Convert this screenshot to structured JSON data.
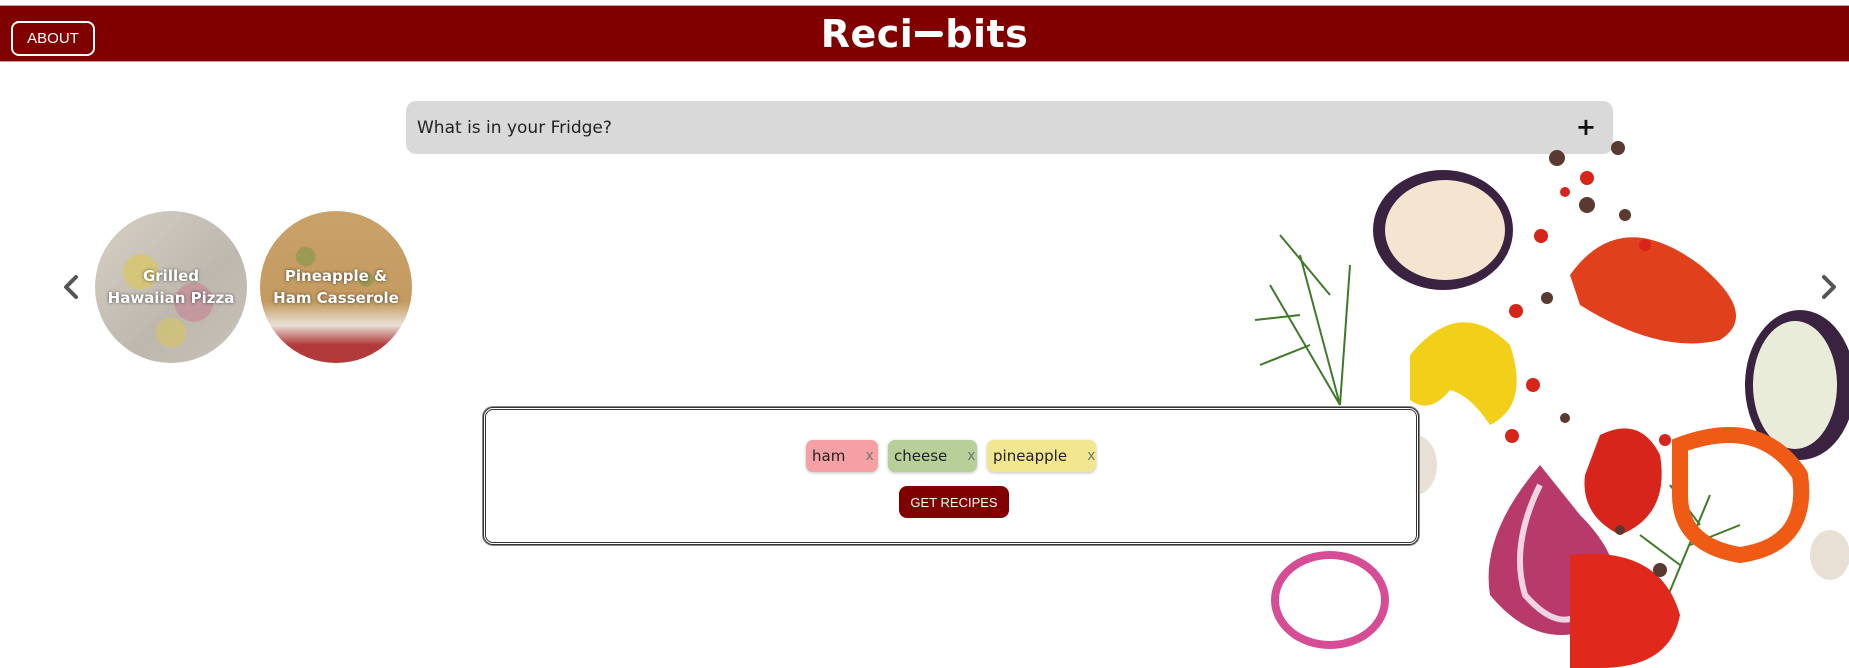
{
  "header": {
    "about_label": "ABOUT",
    "logo_left": "Reci",
    "logo_right": "bits",
    "background_color": "#800000"
  },
  "fridge": {
    "label": "What is in your Fridge?",
    "toggle_icon": "+"
  },
  "carousel": {
    "prev_icon": "chevron-left-icon",
    "next_icon": "chevron-right-icon",
    "recipes": [
      {
        "title": "Grilled Hawaiian Pizza"
      },
      {
        "title": "Pineapple & Ham Casserole"
      }
    ]
  },
  "ingredients": {
    "chips": [
      {
        "label": "ham",
        "remove": "x",
        "color": "#f4a0a4"
      },
      {
        "label": "cheese",
        "remove": "x",
        "color": "#b7cf98"
      },
      {
        "label": "pineapple",
        "remove": "x",
        "color": "#f2e68e"
      }
    ],
    "submit_label": "GET RECIPES"
  },
  "decoration": {
    "image": "vegetables-illustration"
  }
}
